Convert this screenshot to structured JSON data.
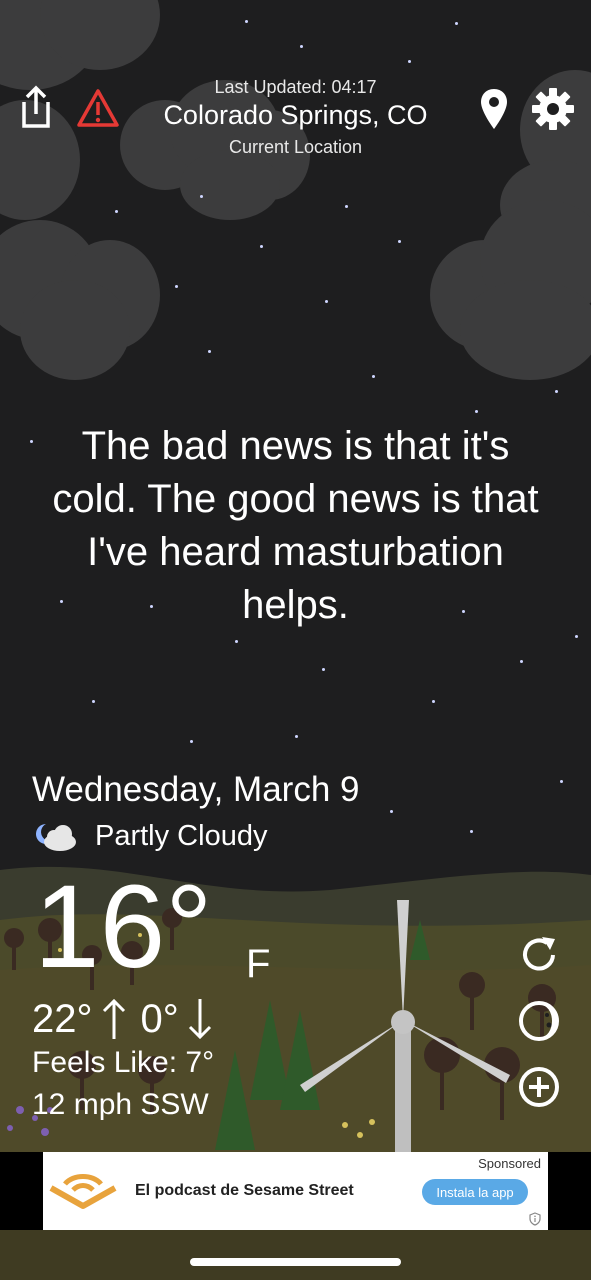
{
  "header": {
    "last_updated": "Last Updated: 04:17",
    "city": "Colorado Springs, CO",
    "location_label": "Current Location"
  },
  "icons": {
    "share": "share-icon",
    "alert": "warning-icon",
    "location": "location-pin-icon",
    "settings": "gear-icon",
    "refresh": "refresh-icon",
    "moon": "moon-icon",
    "add": "plus-circle-icon",
    "condition": "partly-cloudy-night-icon"
  },
  "quote": {
    "lines": [
      "The bad news is that it's",
      "cold. The good news is that",
      "I've heard masturbation",
      "helps."
    ]
  },
  "weather": {
    "date": "Wednesday, March 9",
    "condition": "Partly Cloudy",
    "temp": "16°",
    "unit": "F",
    "high": "22°",
    "low": "0°",
    "feels_like": "Feels Like: 7°",
    "wind": "12 mph SSW"
  },
  "ad": {
    "sponsored": "Sponsored",
    "title": "El podcast de Sesame Street",
    "cta": "Instala la app"
  },
  "colors": {
    "sky": "#1e1e1f",
    "cloud": "#3c3c3d",
    "alert_red": "#e53935",
    "ad_button": "#5aa9e6",
    "ad_logo": "#e8a33c"
  }
}
